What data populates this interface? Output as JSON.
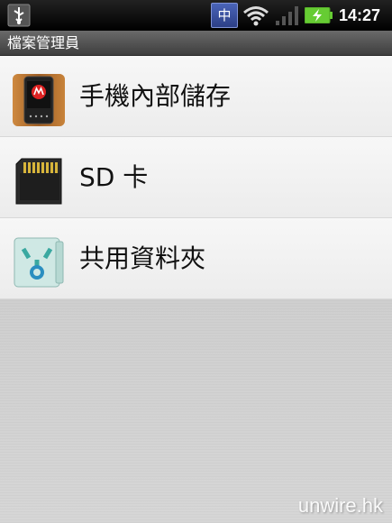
{
  "status_bar": {
    "ime_label": "中",
    "time": "14:27",
    "icons": [
      "usb-icon",
      "wifi-icon",
      "signal-icon",
      "battery-charging-icon"
    ],
    "battery_color": "#66cc33"
  },
  "title_bar": {
    "title": "檔案管理員"
  },
  "list": {
    "items": [
      {
        "label": "手機內部儲存",
        "icon": "phone-storage-icon"
      },
      {
        "label": "SD 卡",
        "icon": "sd-card-icon"
      },
      {
        "label": "共用資料夾",
        "icon": "shared-folder-icon"
      }
    ]
  },
  "watermark": "unwire.hk"
}
